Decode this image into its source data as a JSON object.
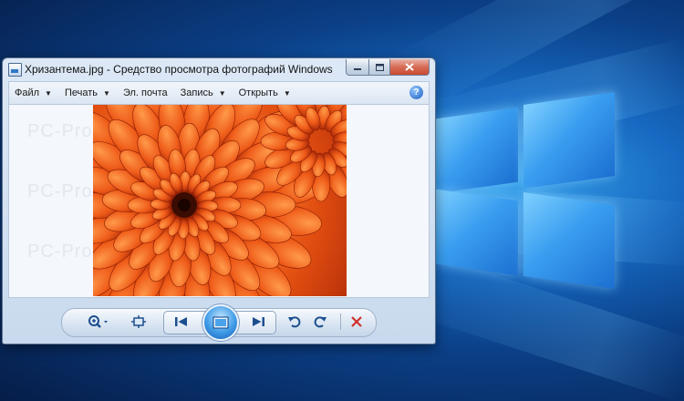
{
  "window": {
    "title": "Хризантема.jpg - Средство просмотра фотографий Windows"
  },
  "menu": [
    {
      "label": "Файл",
      "has_dropdown": true
    },
    {
      "label": "Печать",
      "has_dropdown": true
    },
    {
      "label": "Эл. почта",
      "has_dropdown": false
    },
    {
      "label": "Запись",
      "has_dropdown": true
    },
    {
      "label": "Открыть",
      "has_dropdown": true
    }
  ],
  "help": {
    "icon": "help-icon",
    "glyph": "?"
  },
  "watermark": "PC-Problems.RU",
  "controls": {
    "zoom": {
      "icon": "zoom-icon"
    },
    "actual_size": {
      "icon": "fit-size-icon"
    },
    "previous": {
      "icon": "previous-icon"
    },
    "slideshow": {
      "icon": "slideshow-icon"
    },
    "next": {
      "icon": "next-icon"
    },
    "rotate_left": {
      "icon": "rotate-left-icon"
    },
    "rotate_right": {
      "icon": "rotate-right-icon"
    },
    "delete": {
      "icon": "delete-icon"
    }
  },
  "colors": {
    "desktop_blue": "#1668c0",
    "photo_orange": "#e85212",
    "delete_red": "#d0302a",
    "accent_blue": "#2f78c4"
  }
}
